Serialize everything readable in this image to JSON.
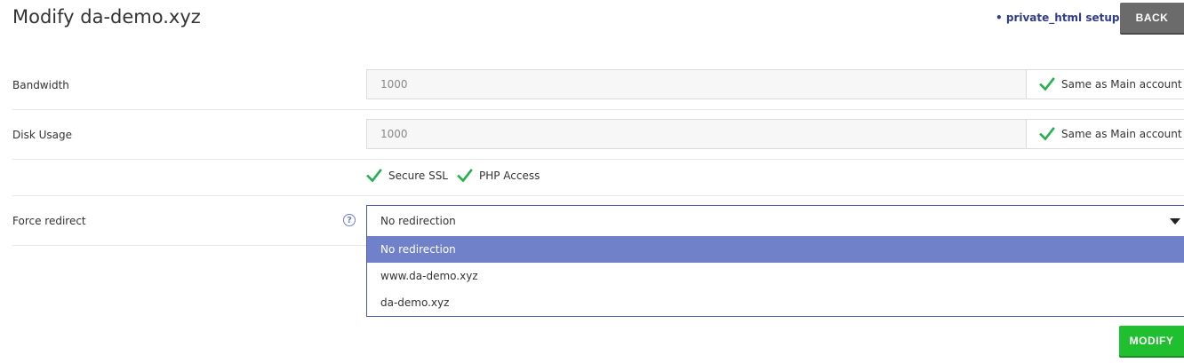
{
  "page": {
    "title": "Modify da-demo.xyz",
    "private_html_link": "private_html setup",
    "back_label": "BACK",
    "modify_label": "MODIFY"
  },
  "fields": {
    "bandwidth": {
      "label": "Bandwidth",
      "value": "1000",
      "same_as_main_label": "Same as Main account",
      "same_as_main_checked": true
    },
    "disk_usage": {
      "label": "Disk Usage",
      "value": "1000",
      "same_as_main_label": "Same as Main account",
      "same_as_main_checked": true
    }
  },
  "options": {
    "secure_ssl": {
      "label": "Secure SSL",
      "checked": true
    },
    "php_access": {
      "label": "PHP Access",
      "checked": true
    }
  },
  "force_redirect": {
    "label": "Force redirect",
    "help_glyph": "?",
    "selected": "No redirection",
    "choices": [
      "No redirection",
      "www.da-demo.xyz",
      "da-demo.xyz"
    ]
  },
  "colors": {
    "check_green": "#22b14c",
    "accent_blue": "#4a5aa8",
    "selected_option": "#7080c9",
    "modify_green": "#1fbf30",
    "back_gray": "#6b6b6b"
  },
  "icons": {
    "check": "check-icon",
    "help": "help-icon",
    "caret": "caret-down-icon"
  }
}
